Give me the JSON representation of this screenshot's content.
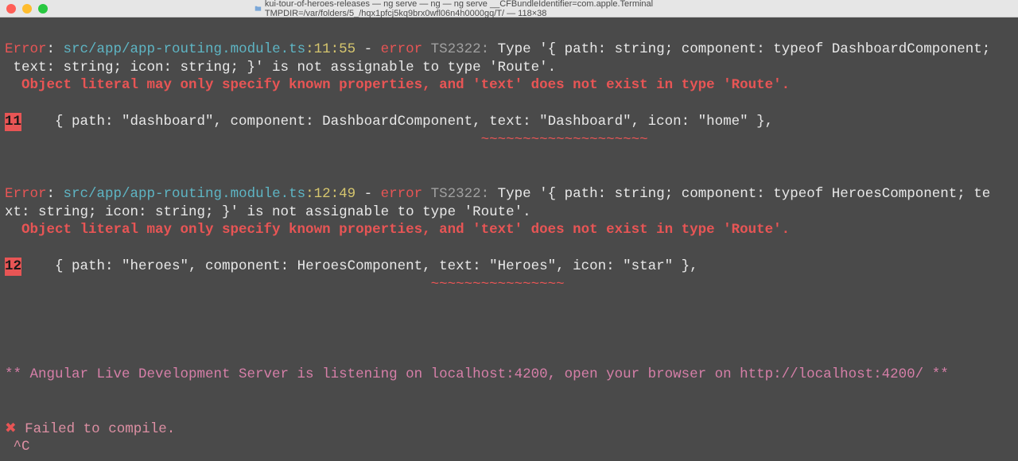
{
  "titlebar": {
    "title": "kui-tour-of-heroes-releases — ng serve — ng — ng serve __CFBundleIdentifier=com.apple.Terminal TMPDIR=/var/folders/5_/hqx1pfcj5kq9brx0wfl06n4h0000gq/T/ — 118×38"
  },
  "err1": {
    "prefix": "Error",
    "colon_space": ": ",
    "file": "src/app/app-routing.module.ts",
    "loc": ":11:55",
    "dash": " - ",
    "label": "error",
    "code": " TS2322: ",
    "msg_a": "Type '{ path: string; component: typeof DashboardComponent;",
    "msg_b": " text: string; icon: string; }' is not assignable to type 'Route'.",
    "detail": "  Object literal may only specify known properties, and 'text' does not exist in type 'Route'.",
    "ln": "11",
    "code_line": "    { path: \"dashboard\", component: DashboardComponent, text: \"Dashboard\", icon: \"home\" },",
    "tilde_pad": "                                                         ",
    "tilde": "~~~~~~~~~~~~~~~~~~~~"
  },
  "err2": {
    "prefix": "Error",
    "colon_space": ": ",
    "file": "src/app/app-routing.module.ts",
    "loc": ":12:49",
    "dash": " - ",
    "label": "error",
    "code": " TS2322: ",
    "msg_a": "Type '{ path: string; component: typeof HeroesComponent; te",
    "msg_b": "xt: string; icon: string; }' is not assignable to type 'Route'.",
    "detail": "  Object literal may only specify known properties, and 'text' does not exist in type 'Route'.",
    "ln": "12",
    "code_line": "    { path: \"heroes\", component: HeroesComponent, text: \"Heroes\", icon: \"star\" },",
    "tilde_pad": "                                                   ",
    "tilde": "~~~~~~~~~~~~~~~~"
  },
  "footer": {
    "server_line": "** Angular Live Development Server is listening on localhost:4200, open your browser on http://localhost:4200/ **",
    "x": "✖",
    "failed": " Failed to compile.",
    "ctrlc": " ^C"
  }
}
